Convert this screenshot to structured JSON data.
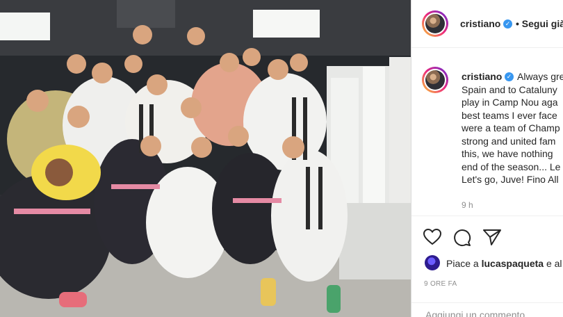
{
  "post": {
    "author": "cristiano",
    "follow_label": "• Segui già",
    "caption_lines": [
      "Always gre",
      "Spain and to Cataluny",
      "play in Camp Nou aga",
      "best teams I ever face",
      "were a team of Champ",
      "strong and united fam",
      "this, we have nothing",
      "end of the season... Le",
      "Let's go, Juve! Fino All"
    ],
    "time_ago": "9 h",
    "liked_by_prefix": "Piace a",
    "liked_by_user": "lucaspaqueta",
    "liked_by_suffix": "e al",
    "date_label": "9 ORE FA",
    "comment_placeholder": "Aggiungi un commento..."
  },
  "icons": {
    "verified": "verified-badge-icon",
    "like": "heart-icon",
    "comment": "comment-icon",
    "share": "paper-plane-icon"
  },
  "colors": {
    "verified": "#3897f0",
    "text": "#262626",
    "muted": "#8e8e8e"
  }
}
